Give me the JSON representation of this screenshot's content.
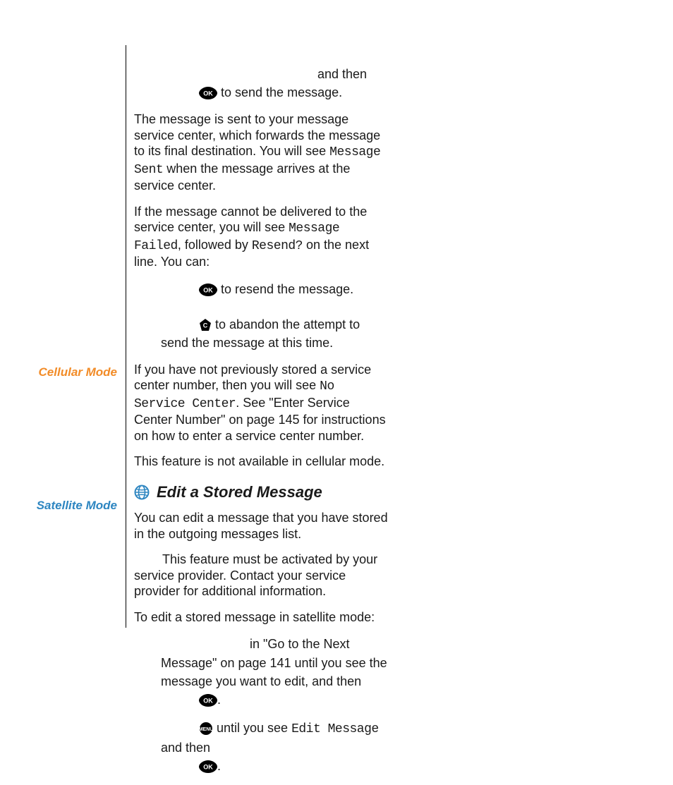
{
  "side": {
    "cellular": "Cellular Mode",
    "satellite": "Satellite Mode"
  },
  "top": {
    "line1_tail": "and then",
    "line2_tail": " to send the message."
  },
  "p_sent_1": "The message is sent to your message service center, which forwards the message to its final destination. You will see ",
  "msg_sent": "Message Sent",
  "p_sent_2": " when the message arrives at the service center.",
  "p_fail_1": "If the message cannot be delivered to the service center, you will see ",
  "msg_failed": "Message Failed",
  "p_fail_2": ", followed by ",
  "resend": "Resend?",
  "p_fail_3": " on the next line. You can:",
  "b_resend": " to resend the message.",
  "b_abandon": " to abandon the attempt to send the message at this time.",
  "p_nosc_1": "If you have not previously stored a service center number, then you will see ",
  "no_sc": "No Service Center",
  "p_nosc_2": ". See \"Enter Service Center Number\" on page 145 for instructions on how to enter a service center number.",
  "p_cellular": "This feature is not available in cellular mode.",
  "heading": "Edit a Stored Message",
  "p_edit_intro": "You can edit a message that you have stored in the outgoing messages list.",
  "p_activate": "This feature must be activated by your service provider. Contact your service provider for additional information.",
  "p_sat_intro": "To edit a stored message in satellite mode:",
  "step1_a": "in \"Go to the Next Message\" on page 141 until you see the message you want to edit, and then ",
  "step2_a": " until you see ",
  "edit_msg": "Edit Message",
  "step2_b": " and then ",
  "dot": "."
}
